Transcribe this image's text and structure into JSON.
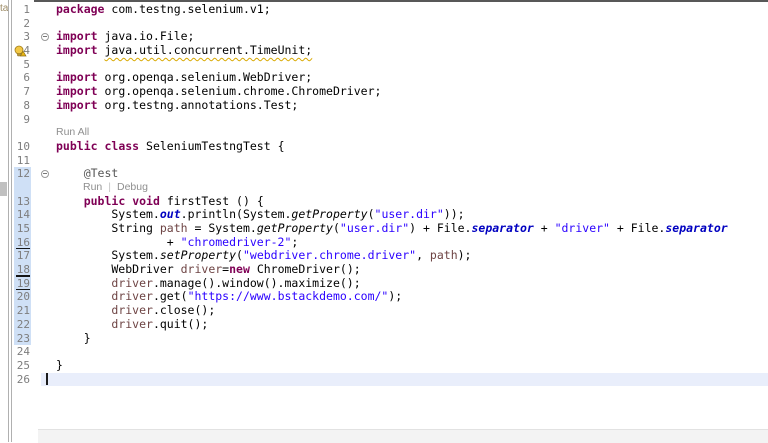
{
  "left_panel": {
    "label": "ta"
  },
  "palette": {
    "kw": "#7f0055",
    "str": "#2a00ff",
    "stf": "#0000c0",
    "var": "#6e4444",
    "an": "#575757",
    "lens": "#8f8f8f",
    "lens-sep": "#c4c4c4",
    "ln": "#7d7d7d",
    "sq": "#d8a800",
    "range-bar": "#cfe0f6",
    "cur-line": "#e9eefb",
    "caret": "#1c1c1c",
    "gutter-border": "#b0b0b0",
    "top-border": "#585858",
    "bottom-band": "#f3f3f3",
    "bottom-border": "#e2e2e2",
    "thumb": "#c0c0c0",
    "ta": "#9c8a64",
    "bulb": "#f2c744"
  },
  "codelens": {
    "run_all": "Run All",
    "run": "Run",
    "separator": "|",
    "debug": "Debug"
  },
  "rows": [
    {
      "n": "1",
      "t": [
        [
          "k",
          "package"
        ],
        [
          "p",
          " com.testng.selenium.v1;"
        ]
      ]
    },
    {
      "n": "2",
      "t": []
    },
    {
      "n": "3",
      "fold": true,
      "t": [
        [
          "k",
          "import"
        ],
        [
          "p",
          " java.io.File;"
        ]
      ]
    },
    {
      "n": "4",
      "warn": true,
      "t": [
        [
          "k",
          "import"
        ],
        [
          "p",
          " "
        ],
        [
          "psq",
          "java.util.concurrent.TimeUnit;"
        ]
      ]
    },
    {
      "n": "5",
      "t": []
    },
    {
      "n": "6",
      "t": [
        [
          "k",
          "import"
        ],
        [
          "p",
          " org.openqa.selenium.WebDriver;"
        ]
      ]
    },
    {
      "n": "7",
      "t": [
        [
          "k",
          "import"
        ],
        [
          "p",
          " org.openqa.selenium.chrome.ChromeDriver;"
        ]
      ]
    },
    {
      "n": "8",
      "t": [
        [
          "k",
          "import"
        ],
        [
          "p",
          " org.testng.annotations.Test;"
        ]
      ]
    },
    {
      "n": "9",
      "t": []
    },
    {
      "lens": true,
      "ind": 0,
      "t": [
        [
          "lensl",
          "Run All",
          "codelens-run-all-link"
        ]
      ]
    },
    {
      "n": "10",
      "t": [
        [
          "k",
          "public"
        ],
        [
          "p",
          " "
        ],
        [
          "k",
          "class"
        ],
        [
          "p",
          " SeleniumTestngTest {"
        ]
      ]
    },
    {
      "n": "11",
      "t": []
    },
    {
      "n": "12",
      "fold": true,
      "t": [
        [
          "p",
          "    "
        ],
        [
          "an",
          "@Test"
        ]
      ]
    },
    {
      "lens": true,
      "ind": 1,
      "t": [
        [
          "lensl",
          "Run",
          "codelens-run-link"
        ],
        [
          "lsep",
          "|"
        ],
        [
          "lensl",
          "Debug",
          "codelens-debug-link"
        ]
      ]
    },
    {
      "n": "13",
      "t": [
        [
          "p",
          "    "
        ],
        [
          "k",
          "public"
        ],
        [
          "p",
          " "
        ],
        [
          "k",
          "void"
        ],
        [
          "p",
          " firstTest () {"
        ]
      ]
    },
    {
      "n": "14",
      "t": [
        [
          "p",
          "        System."
        ],
        [
          "sf",
          "out"
        ],
        [
          "p",
          ".println(System."
        ],
        [
          "sm",
          "getProperty"
        ],
        [
          "p",
          "("
        ],
        [
          "s",
          "\"user.dir\""
        ],
        [
          "p",
          "));"
        ]
      ]
    },
    {
      "n": "15",
      "t": [
        [
          "p",
          "        String "
        ],
        [
          "v",
          "path"
        ],
        [
          "p",
          " = System."
        ],
        [
          "sm",
          "getProperty"
        ],
        [
          "p",
          "("
        ],
        [
          "s",
          "\"user.dir\""
        ],
        [
          "p",
          ") + File."
        ],
        [
          "sf",
          "separator"
        ],
        [
          "p",
          " + "
        ],
        [
          "s",
          "\"driver\""
        ],
        [
          "p",
          " + File."
        ],
        [
          "sf",
          "separator"
        ]
      ]
    },
    {
      "n": "16",
      "ul": true,
      "t": [
        [
          "p",
          "                + "
        ],
        [
          "s",
          "\"chromedriver-2\""
        ],
        [
          "p",
          ";"
        ]
      ]
    },
    {
      "n": "17",
      "t": [
        [
          "p",
          "        System."
        ],
        [
          "sm",
          "setProperty"
        ],
        [
          "p",
          "("
        ],
        [
          "s",
          "\"webdriver.chrome.driver\""
        ],
        [
          "p",
          ", "
        ],
        [
          "v",
          "path"
        ],
        [
          "p",
          ");"
        ]
      ]
    },
    {
      "n": "18",
      "ul": true,
      "t": [
        [
          "p",
          "        WebDriver "
        ],
        [
          "v",
          "driver"
        ],
        [
          "p",
          "="
        ],
        [
          "k",
          "new"
        ],
        [
          "p",
          " ChromeDriver();"
        ]
      ]
    },
    {
      "n": "19",
      "ul": true,
      "t": [
        [
          "p",
          "        "
        ],
        [
          "v",
          "driver"
        ],
        [
          "p",
          ".manage().window().maximize();"
        ]
      ]
    },
    {
      "n": "20",
      "t": [
        [
          "p",
          "        "
        ],
        [
          "v",
          "driver"
        ],
        [
          "p",
          ".get("
        ],
        [
          "s",
          "\"https://www.bstackdemo.com/\""
        ],
        [
          "p",
          ");"
        ]
      ]
    },
    {
      "n": "21",
      "t": [
        [
          "p",
          "        "
        ],
        [
          "v",
          "driver"
        ],
        [
          "p",
          ".close();"
        ]
      ]
    },
    {
      "n": "22",
      "t": [
        [
          "p",
          "        "
        ],
        [
          "v",
          "driver"
        ],
        [
          "p",
          ".quit();"
        ]
      ]
    },
    {
      "n": "23",
      "t": [
        [
          "p",
          "    }"
        ]
      ]
    },
    {
      "n": "24",
      "t": []
    },
    {
      "n": "25",
      "t": [
        [
          "p",
          "}"
        ]
      ]
    },
    {
      "n": "26",
      "cur": true,
      "t": []
    }
  ]
}
